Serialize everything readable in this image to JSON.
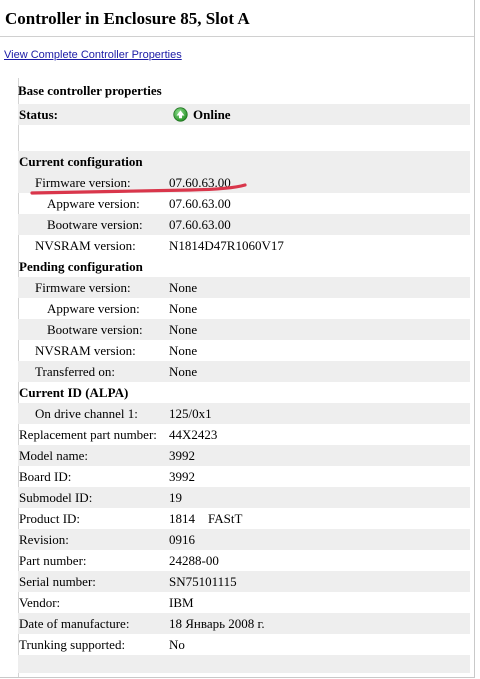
{
  "page": {
    "title": "Controller in Enclosure 85, Slot A",
    "link": "View Complete Controller Properties"
  },
  "base": {
    "header": "Base controller properties",
    "status_label": "Status:",
    "status_value": "Online",
    "status_icon": "online-circle-up-arrow-icon",
    "status_color": "#2e9a2e"
  },
  "current_config": {
    "header": "Current configuration",
    "firmware_label": "Firmware version:",
    "firmware_value": "07.60.63.00",
    "appware_label": "Appware version:",
    "appware_value": "07.60.63.00",
    "bootware_label": "Bootware version:",
    "bootware_value": "07.60.63.00",
    "nvsram_label": "NVSRAM version:",
    "nvsram_value": "N1814D47R1060V17",
    "annotation_color": "#d9364b"
  },
  "pending_config": {
    "header": "Pending configuration",
    "firmware_label": "Firmware version:",
    "firmware_value": "None",
    "appware_label": "Appware version:",
    "appware_value": "None",
    "bootware_label": "Bootware version:",
    "bootware_value": "None",
    "nvsram_label": "NVSRAM version:",
    "nvsram_value": "None",
    "transferred_label": "Transferred on:",
    "transferred_value": "None"
  },
  "current_id": {
    "header": "Current ID (ALPA)",
    "channel_label": "On drive channel 1:",
    "channel_value": "125/0x1"
  },
  "details": {
    "replacement_label": "Replacement part number:",
    "replacement_value": "44X2423",
    "model_label": "Model name:",
    "model_value": "3992",
    "board_label": "Board ID:",
    "board_value": "3992",
    "submodel_label": "Submodel ID:",
    "submodel_value": "19",
    "product_label": "Product ID:",
    "product_value": "1814    FAStT",
    "revision_label": "Revision:",
    "revision_value": "0916",
    "part_label": "Part number:",
    "part_value": "24288-00",
    "serial_label": "Serial number:",
    "serial_value": "SN75101115",
    "vendor_label": "Vendor:",
    "vendor_value": "IBM",
    "date_label": "Date of manufacture:",
    "date_value": "18 Январь 2008 г.",
    "trunking_label": "Trunking supported:",
    "trunking_value": "No"
  }
}
